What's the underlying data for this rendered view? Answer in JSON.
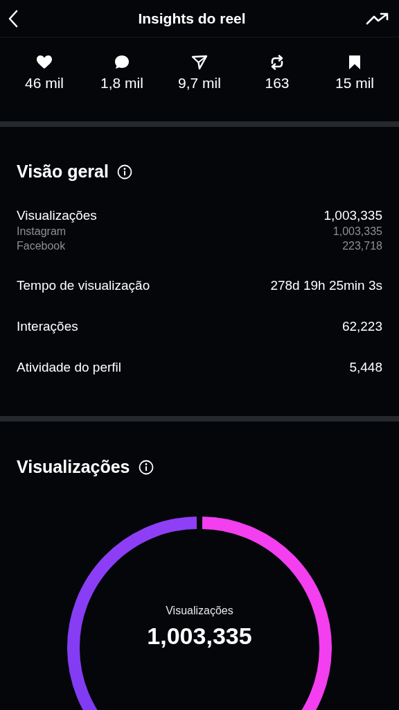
{
  "header": {
    "title": "Insights do reel"
  },
  "stats": [
    {
      "kind": "heart",
      "value": "46 mil"
    },
    {
      "kind": "comment",
      "value": "1,8 mil"
    },
    {
      "kind": "send",
      "value": "9,7 mil"
    },
    {
      "kind": "repost",
      "value": "163"
    },
    {
      "kind": "bookmark",
      "value": "15 mil"
    }
  ],
  "overview": {
    "title": "Visão geral",
    "rows": [
      {
        "label": "Visualizações",
        "value": "1,003,335",
        "sub": [
          {
            "label": "Instagram",
            "value": "1,003,335"
          },
          {
            "label": "Facebook",
            "value": "223,718"
          }
        ]
      },
      {
        "label": "Tempo de visualização",
        "value": "278d 19h 25min 3s"
      },
      {
        "label": "Interações",
        "value": "62,223"
      },
      {
        "label": "Atividade do perfil",
        "value": "5,448"
      }
    ]
  },
  "views": {
    "title": "Visualizações",
    "center_label": "Visualizações",
    "center_value": "1,003,335"
  }
}
